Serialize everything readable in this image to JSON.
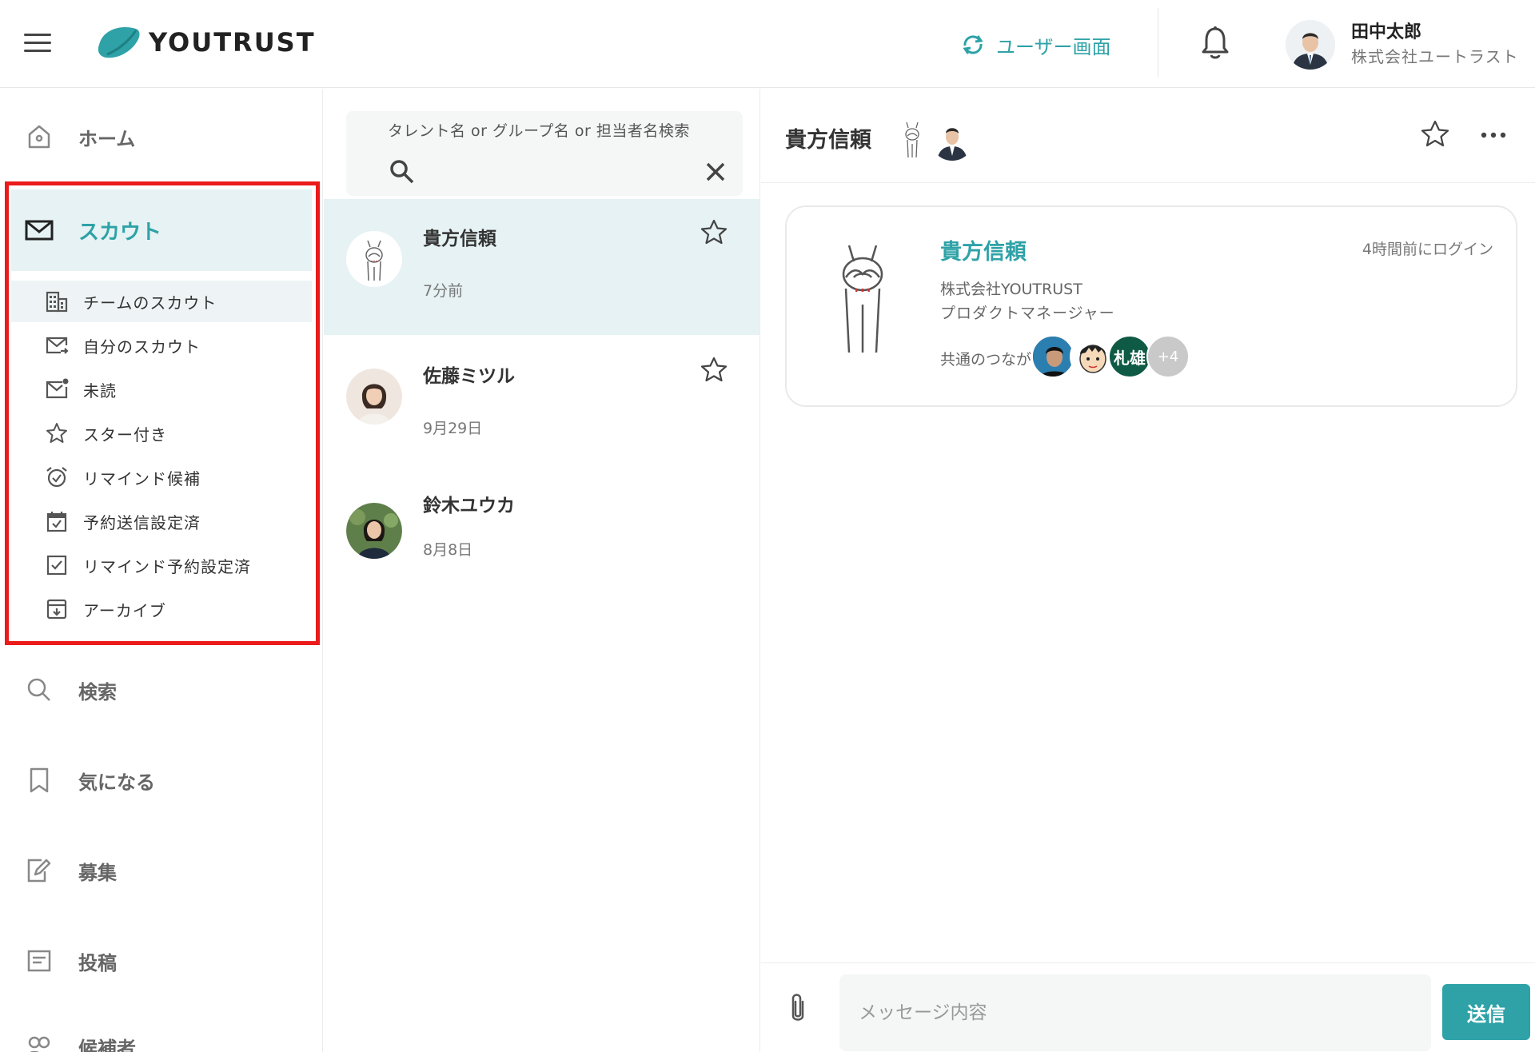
{
  "header": {
    "brand": "YOUTRUST",
    "switch_label": "ユーザー画面",
    "user_name": "田中太郎",
    "user_company": "株式会社ユートラスト",
    "accent_color": "#2ea2a7"
  },
  "nav": {
    "home": "ホーム",
    "scout": "スカウト",
    "scout_sub": [
      {
        "label": "チームのスカウト",
        "icon": "building-icon"
      },
      {
        "label": "自分のスカウト",
        "icon": "mail-send-icon"
      },
      {
        "label": "未読",
        "icon": "mail-unread-icon"
      },
      {
        "label": "スター付き",
        "icon": "star-icon"
      },
      {
        "label": "リマインド候補",
        "icon": "alarm-icon"
      },
      {
        "label": "予約送信設定済",
        "icon": "calendar-check-icon"
      },
      {
        "label": "リマインド予約設定済",
        "icon": "checkbox-icon"
      },
      {
        "label": "アーカイブ",
        "icon": "archive-icon"
      }
    ],
    "search": "検索",
    "bookmark": "気になる",
    "recruit": "募集",
    "post": "投稿",
    "candidates": "候補者"
  },
  "list": {
    "search_placeholder": "タレント名 or グループ名 or 担当者名検索",
    "conversations": [
      {
        "name": "貴方信頼",
        "time": "7分前"
      },
      {
        "name": "佐藤ミツル",
        "time": "9月29日"
      },
      {
        "name": "鈴木ユウカ",
        "time": "8月8日"
      }
    ]
  },
  "chat": {
    "title": "貴方信頼",
    "profile": {
      "name": "貴方信頼",
      "last_login": "4時間前にログイン",
      "company": "株式会社YOUTRUST",
      "role": "プロダクトマネージャー",
      "mutual_label": "共通のつながり",
      "mutual_avatar_text": "札雄",
      "mutual_more": "+4"
    },
    "message_placeholder": "メッセージ内容",
    "send_label": "送信"
  }
}
